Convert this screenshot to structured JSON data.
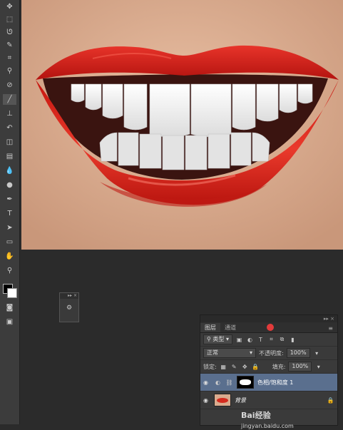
{
  "tools": [
    "move",
    "marquee",
    "lasso",
    "quick-select",
    "crop",
    "eyedropper",
    "healing",
    "brush",
    "stamp",
    "history-brush",
    "eraser",
    "gradient",
    "blur",
    "dodge",
    "pen",
    "type",
    "path-select",
    "shape",
    "hand",
    "zoom"
  ],
  "layers_panel": {
    "tabs": [
      "图层",
      "通道"
    ],
    "filter_label": "类型",
    "blend_mode": "正常",
    "opacity_label": "不透明度:",
    "opacity_value": "100%",
    "lock_label": "锁定:",
    "fill_label": "填充:",
    "fill_value": "100%",
    "layers": [
      {
        "name": "色相/饱和度 1",
        "selected": true
      },
      {
        "name": "背景",
        "selected": false
      }
    ]
  },
  "watermark": "jingyan.baidu.com",
  "watermark_brand": "Bai经验",
  "colors": {
    "lip": "#e0261d",
    "skin": "#d9ab8e",
    "selected_layer": "#5a6f8e"
  }
}
